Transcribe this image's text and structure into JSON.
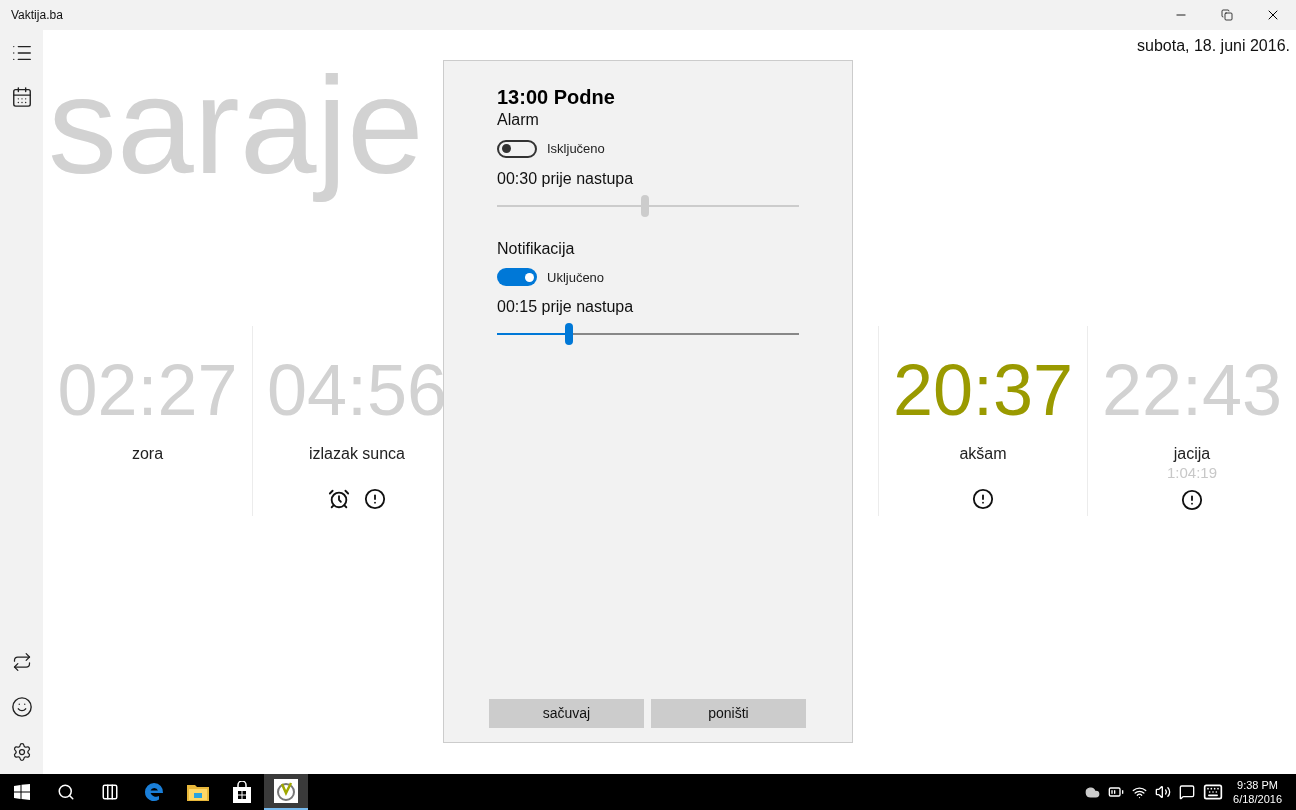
{
  "window": {
    "title": "Vaktija.ba"
  },
  "date": "subota, 18. juni 2016.",
  "city": "saraje",
  "prayers_left": [
    {
      "time": "02:27",
      "name": "zora",
      "current": false,
      "alarm": false,
      "notification": false
    },
    {
      "time": "04:56",
      "name": "izlazak sunca",
      "current": false,
      "alarm": true,
      "notification": true
    }
  ],
  "prayers_right": [
    {
      "time": "20:37",
      "name": "akšam",
      "current": true,
      "alarm": false,
      "notification": true
    },
    {
      "time": "22:43",
      "name": "jacija",
      "countdown": "1:04:19",
      "current": false,
      "alarm": false,
      "notification": true
    }
  ],
  "dialog": {
    "title": "13:00 Podne",
    "sections": [
      {
        "label": "Alarm",
        "toggle": {
          "on": false,
          "label": "Isključeno"
        },
        "offset": "00:30 prije nastupa",
        "level": 0.49
      },
      {
        "label": "Notifikacija",
        "toggle": {
          "on": true,
          "label": "Uključeno"
        },
        "offset": "00:15 prije nastupa",
        "level": 0.24
      }
    ],
    "buttons": [
      "sačuvaj",
      "poništi"
    ]
  },
  "taskbar": {
    "apps": [
      {
        "kind": "start",
        "selected": false
      },
      {
        "kind": "search",
        "selected": false
      },
      {
        "kind": "taskview",
        "selected": false
      },
      {
        "kind": "browser",
        "selected": false
      },
      {
        "kind": "folder",
        "selected": false
      },
      {
        "kind": "store",
        "selected": false
      },
      {
        "kind": "vaktija",
        "selected": true
      }
    ],
    "time": "9:38 PM",
    "date": "6/18/2016"
  }
}
